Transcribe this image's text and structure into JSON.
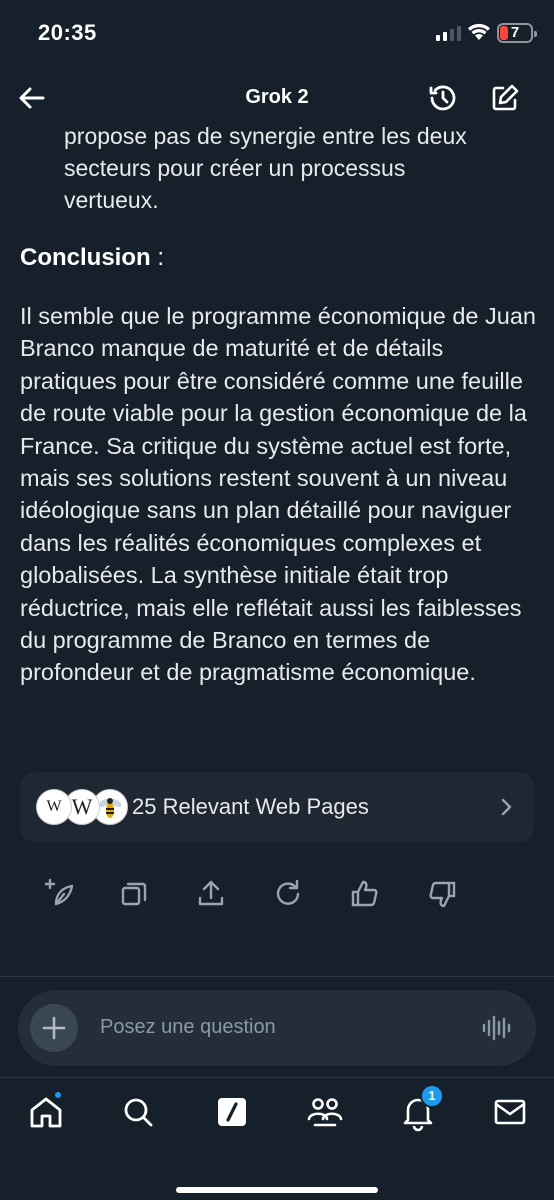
{
  "status": {
    "time": "20:35",
    "battery": "7"
  },
  "header": {
    "title": "Grok 2"
  },
  "message": {
    "cut_line_1": "propose pas de synergie entre les deux",
    "cut_line_2": "secteurs pour créer un processus",
    "cut_line_3": "vertueux.",
    "conclusion_heading": "Conclusion",
    "conclusion_colon": " :",
    "paragraph": "Il semble que le programme économique de Juan Branco manque de maturité et de détails pratiques pour être considéré comme une feuille de route viable pour la gestion économique de la France. Sa critique du système actuel est forte, mais ses solutions restent souvent à un niveau idéologique sans un plan détaillé pour naviguer dans les réalités économiques complexes et globalisées. La synthèse initiale était trop réductrice, mais elle reflétait aussi les faiblesses du programme de Branco en termes de profondeur et de pragmatisme économique."
  },
  "sources": {
    "label": "25 Relevant Web Pages",
    "favicons": [
      "wikipedia-small-icon",
      "wikipedia-icon",
      "wasp-icon"
    ],
    "fav1_text": "W",
    "fav2_text": "W"
  },
  "actions": [
    "regenerate-sparkle-icon",
    "copy-icon",
    "share-icon",
    "refresh-icon",
    "thumbs-up-icon",
    "thumbs-down-icon"
  ],
  "composer": {
    "placeholder": "Posez une question"
  },
  "nav": {
    "items": [
      "home-icon",
      "search-icon",
      "grok-icon",
      "communities-icon",
      "notifications-icon",
      "messages-icon"
    ],
    "notification_count": "1"
  },
  "colors": {
    "background": "#15202b",
    "accent": "#1d9bf0",
    "card": "#1e2732"
  }
}
